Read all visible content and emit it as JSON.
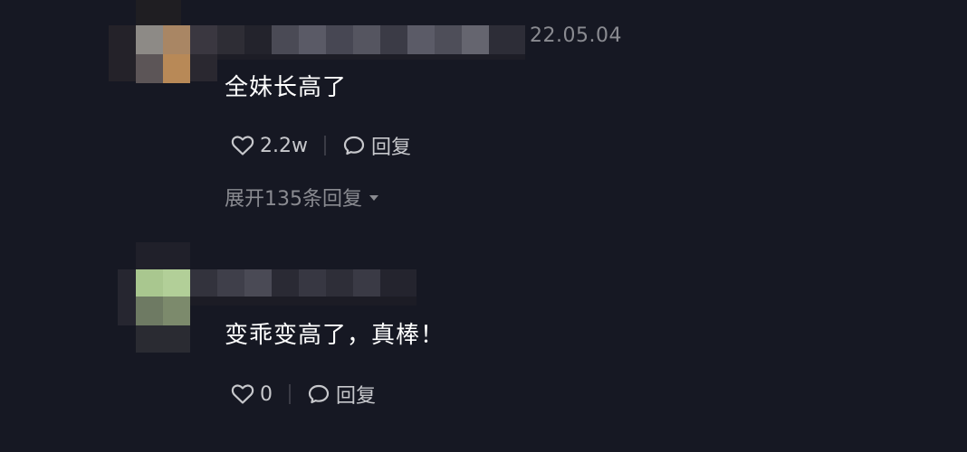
{
  "comments": [
    {
      "timestamp": "22.05.04",
      "text": "全妹长高了",
      "likes": "2.2w",
      "reply_label": "回复",
      "expand_label": "展开135条回复"
    },
    {
      "text": "变乖变高了，真棒！",
      "likes": "0",
      "reply_label": "回复"
    }
  ],
  "colors": {
    "background": "#161823",
    "text": "#ffffff",
    "secondary": "#8a8b91",
    "action": "#c7c8cc"
  },
  "icons": [
    "heart-icon",
    "comment-bubble-icon",
    "caret-down-icon"
  ]
}
